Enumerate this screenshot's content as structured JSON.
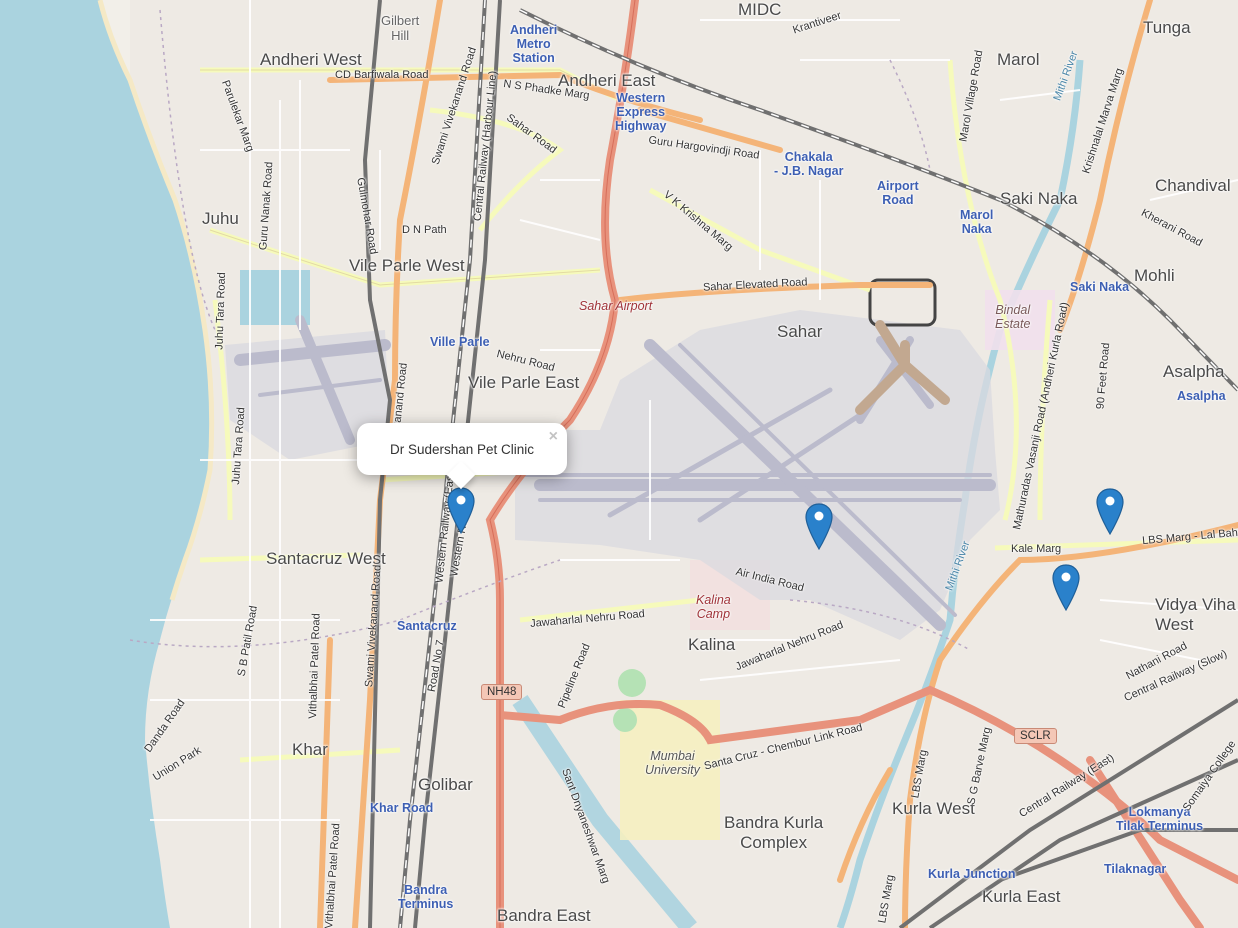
{
  "map": {
    "popup": {
      "title": "Dr Sudershan Pet Clinic",
      "close_symbol": "×"
    },
    "markers": [
      {
        "name": "marker-dr-sudershan-pet-clinic"
      },
      {
        "name": "marker-2"
      },
      {
        "name": "marker-3"
      },
      {
        "name": "marker-4"
      }
    ],
    "colors": {
      "water": "#aad3df",
      "land": "#f2efe9",
      "major_road": "#e8927c",
      "trunk_road": "#f4b478",
      "secondary_road": "#f6fabb",
      "railway": "#707070",
      "airport": "#dadae0",
      "runway": "#bbbbcc",
      "marker": "#2a81cb"
    },
    "places": {
      "andheri_west": "Andheri West",
      "andheri_east": "Andheri East",
      "midc": "MIDC",
      "marol": "Marol",
      "tunga": "Tunga",
      "gilbert_hill": "Gilbert\nHill",
      "juhu": "Juhu",
      "vile_parle_west": "Vile Parle West",
      "vile_parle_east": "Vile Parle East",
      "sahar": "Sahar",
      "saki_naka": "Saki Naka",
      "chandivali": "Chandival",
      "mohli": "Mohli",
      "asalpha": "Asalpha",
      "santacruz_west": "Santacruz West",
      "kalina": "Kalina",
      "vidya_vihar_west": "Vidya Viha\nWest",
      "khar": "Khar",
      "golibar": "Golibar",
      "bkc": "Bandra Kurla\nComplex",
      "kurla_west": "Kurla West",
      "kurla_east": "Kurla East",
      "bandra_east": "Bandra East",
      "mumbai_university": "Mumbai\nUniversity",
      "kalina_camp": "Kalina\nCamp",
      "bindal_estate": "Bindal\nEstate",
      "sahar_airport": "Sahar Airport"
    },
    "stations": {
      "andheri_metro": "Andheri\nMetro\nStation",
      "western_express": "Western\nExpress\nHighway",
      "chakala": "Chakala\n- J.B. Nagar",
      "airport_road": "Airport\nRoad",
      "marol_naka": "Marol\nNaka",
      "saki_naka_st": "Saki Naka",
      "asalpha_st": "Asalpha",
      "ville_parle": "Ville Parle",
      "santacruz": "Santacruz",
      "khar_road": "Khar Road",
      "bandra_terminus": "Bandra\nTerminus",
      "kurla_junction": "Kurla Junction",
      "ltt": "Lokmanya\nTilak Terminus",
      "tilaknagar": "Tilaknagar"
    },
    "roads": {
      "cd_barfiwala": "CD Barfiwala Road",
      "ns_phadke": "N S Phadke Marg",
      "guru_hargovindji": "Guru Hargovindji Road",
      "vk_krishna": "V K Krishna Marg",
      "sahar_elevated": "Sahar Elevated Road",
      "nehru": "Nehru Road",
      "dn_path": "D N Path",
      "sahar_road": "Sahar Road",
      "jawaharlal_nehru": "Jawaharlal Nehru Road",
      "jawaharlal_nehru2": "Jawaharlal Nehru Road",
      "air_india": "Air India Road",
      "kale_marg": "Kale Marg",
      "lbs_marg": "LBS Marg - Lal Bah",
      "nathani": "Nathani Road",
      "santacruz_chembur": "Santa Cruz - Chembur Link Road",
      "kherani": "Kherani Road",
      "krantiveer": "Krantiveer",
      "union_park": "Union Park",
      "danda": "Danda Road",
      "pipeline": "Pipeline Road",
      "sant_dnyaneshwar": "Sant Dnyaneshwar Marg",
      "road_no_7": "Road No 7",
      "feet_90": "90 Feet Road",
      "sg_barve": "S G Barve Marg",
      "lbs_marg_v": "LBS Marg",
      "lbs_marg_v2": "LBS Marg",
      "swami_vivekanand": "Swami Vivekanand Road",
      "swami_vivekanand2": "Swami Vivekanand Road",
      "vithalbhai": "Vithalbhai Patel Road",
      "vithalbhai2": "Vithalbhai Patel Road",
      "sb_patil": "S B Patil Road",
      "juhu_tara": "Juhu Tara Road",
      "juhu_tara2": "Juhu Tara Road",
      "guru_nanak": "Guru Nanak Road",
      "gulmohar": "Gulmohar Road",
      "parulekar": "Parulekar Marg",
      "central_harbour": "Central Railway (Harbour Line)",
      "western_railway": "Western Railway (East)",
      "western_railway2": "Western Railway",
      "mathuradas": "Mathuradas Vasanji Road (Andheri Kurla Road)",
      "marol_village": "Marol Village Road",
      "krishnalal": "Krishnalal Marva Marg",
      "central_railway_slow": "Central Railway (Slow)",
      "central_railway_east": "Central Railway (East)",
      "somaiya": "Somaiya College",
      "mithi_river": "Mithi River",
      "mithi_river2": "Mithi River",
      "vakanand": "Vivekanand Road"
    },
    "shields": {
      "nh48": "NH48",
      "sclr": "SCLR"
    }
  }
}
